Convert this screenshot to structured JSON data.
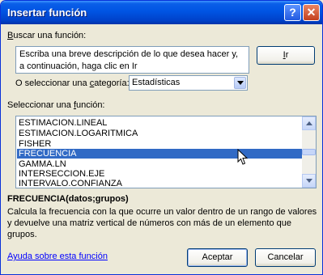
{
  "window": {
    "title": "Insertar función"
  },
  "search": {
    "label_prefix": "",
    "label_accel": "B",
    "label_rest": "uscar una función:",
    "text": "Escriba una breve descripción de lo que desea hacer y, a continuación, haga clic en Ir",
    "go_button_accel": "I",
    "go_button_rest": "r"
  },
  "category": {
    "label_prefix": "O seleccionar una ",
    "label_accel": "c",
    "label_rest": "ategoría:",
    "selected": "Estadísticas"
  },
  "functions": {
    "label_prefix": "Seleccionar una ",
    "label_accel": "f",
    "label_rest": "unción:",
    "items": [
      "ESTIMACION.LINEAL",
      "ESTIMACION.LOGARITMICA",
      "FISHER",
      "FRECUENCIA",
      "GAMMA.LN",
      "INTERSECCION.EJE",
      "INTERVALO.CONFIANZA"
    ],
    "selected_index": 3
  },
  "details": {
    "syntax": "FRECUENCIA(datos;grupos)",
    "description": "Calcula la frecuencia con la que ocurre un valor dentro de un rango de valores y devuelve una matriz vertical de números con más de un elemento que grupos."
  },
  "footer": {
    "help_link": "Ayuda sobre esta función",
    "accept": "Aceptar",
    "cancel": "Cancelar"
  },
  "colors": {
    "title_bar": "#0054e3",
    "selection": "#316ac5",
    "link": "#0000ff",
    "dialog_bg": "#ece9d8"
  },
  "icons": [
    "help-icon",
    "close-icon",
    "dropdown-arrow-icon",
    "scroll-up-icon",
    "scroll-down-icon",
    "mouse-pointer-icon"
  ]
}
